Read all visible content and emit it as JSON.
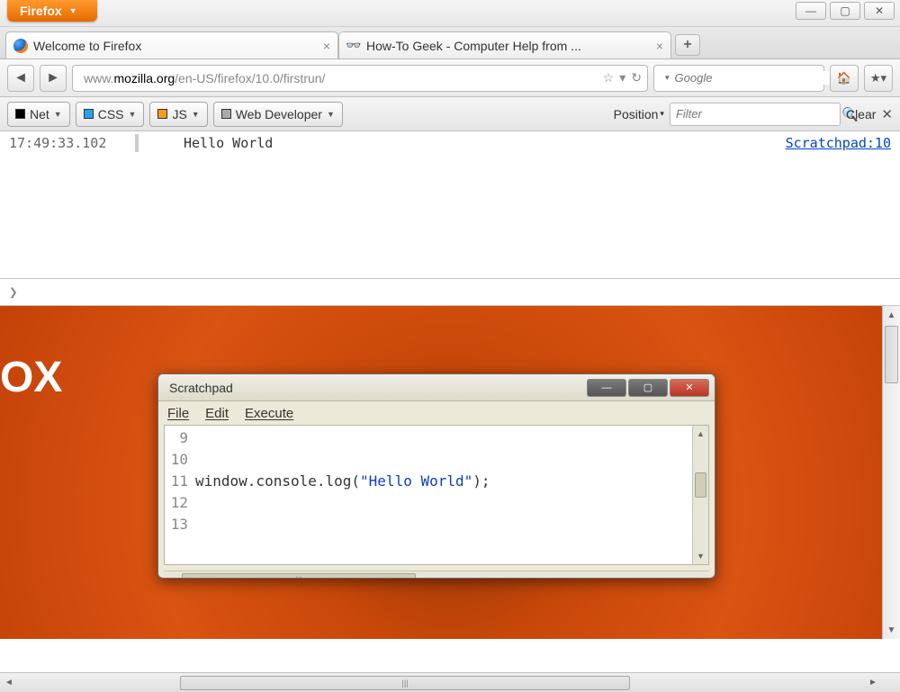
{
  "firefox_button": "Firefox",
  "tabs": [
    {
      "title": "Welcome to Firefox",
      "active": true
    },
    {
      "title": "How-To Geek - Computer Help from ...",
      "active": false
    }
  ],
  "url": {
    "prefix": "www.",
    "domain": "mozilla.org",
    "path": "/en-US/firefox/10.0/firstrun/"
  },
  "search": {
    "placeholder": "Google"
  },
  "devtoolbar": {
    "net": "Net",
    "css": "CSS",
    "js": "JS",
    "webdev": "Web Developer",
    "position": "Position",
    "filter_placeholder": "Filter",
    "clear": "Clear"
  },
  "console_log": {
    "timestamp": "17:49:33.102",
    "message": "Hello World",
    "source": "Scratchpad:10"
  },
  "content_text": "OX",
  "scratchpad": {
    "title": "Scratchpad",
    "menu": {
      "file": "File",
      "edit": "Edit",
      "execute": "Execute"
    },
    "lines": [
      "9",
      "10",
      "11",
      "12",
      "13"
    ],
    "code_prefix": "window.console.log(",
    "code_string": "\"Hello World\"",
    "code_suffix": ");"
  }
}
